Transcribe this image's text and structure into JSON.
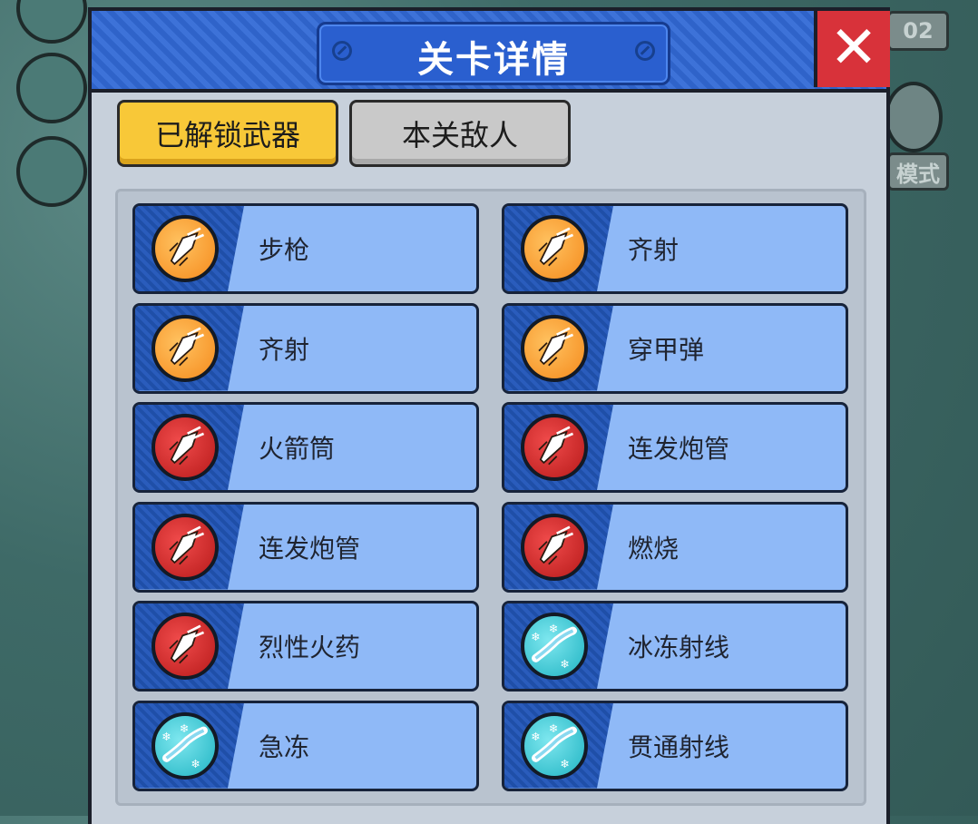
{
  "background": {
    "right_tag": "02",
    "mode_tag": "模式"
  },
  "dialog": {
    "title": "关卡详情",
    "close_label": "✕"
  },
  "tabs": [
    {
      "label": "已解锁武器",
      "active": true
    },
    {
      "label": "本关敌人",
      "active": false
    }
  ],
  "weapons": [
    {
      "name": "步枪",
      "icon": "rocket-orange-icon",
      "color": "orange"
    },
    {
      "name": "齐射",
      "icon": "rocket-orange-icon",
      "color": "orange"
    },
    {
      "name": "齐射",
      "icon": "rocket-orange-icon",
      "color": "orange"
    },
    {
      "name": "穿甲弹",
      "icon": "rocket-orange-icon",
      "color": "orange"
    },
    {
      "name": "火箭筒",
      "icon": "rocket-red-icon",
      "color": "red"
    },
    {
      "name": "连发炮管",
      "icon": "rocket-red-icon",
      "color": "red"
    },
    {
      "name": "连发炮管",
      "icon": "rocket-red-icon",
      "color": "red"
    },
    {
      "name": "燃烧",
      "icon": "rocket-red-icon",
      "color": "red"
    },
    {
      "name": "烈性火药",
      "icon": "rocket-red-icon",
      "color": "red"
    },
    {
      "name": "冰冻射线",
      "icon": "frost-beam-icon",
      "color": "cyan"
    },
    {
      "name": "急冻",
      "icon": "frost-beam-icon",
      "color": "cyan"
    },
    {
      "name": "贯通射线",
      "icon": "frost-beam-icon",
      "color": "cyan"
    }
  ],
  "colors": {
    "header_blue": "#2f63c9",
    "tab_active": "#f8c838",
    "card_blue": "#8fb9f7",
    "close_red": "#d8323a"
  }
}
